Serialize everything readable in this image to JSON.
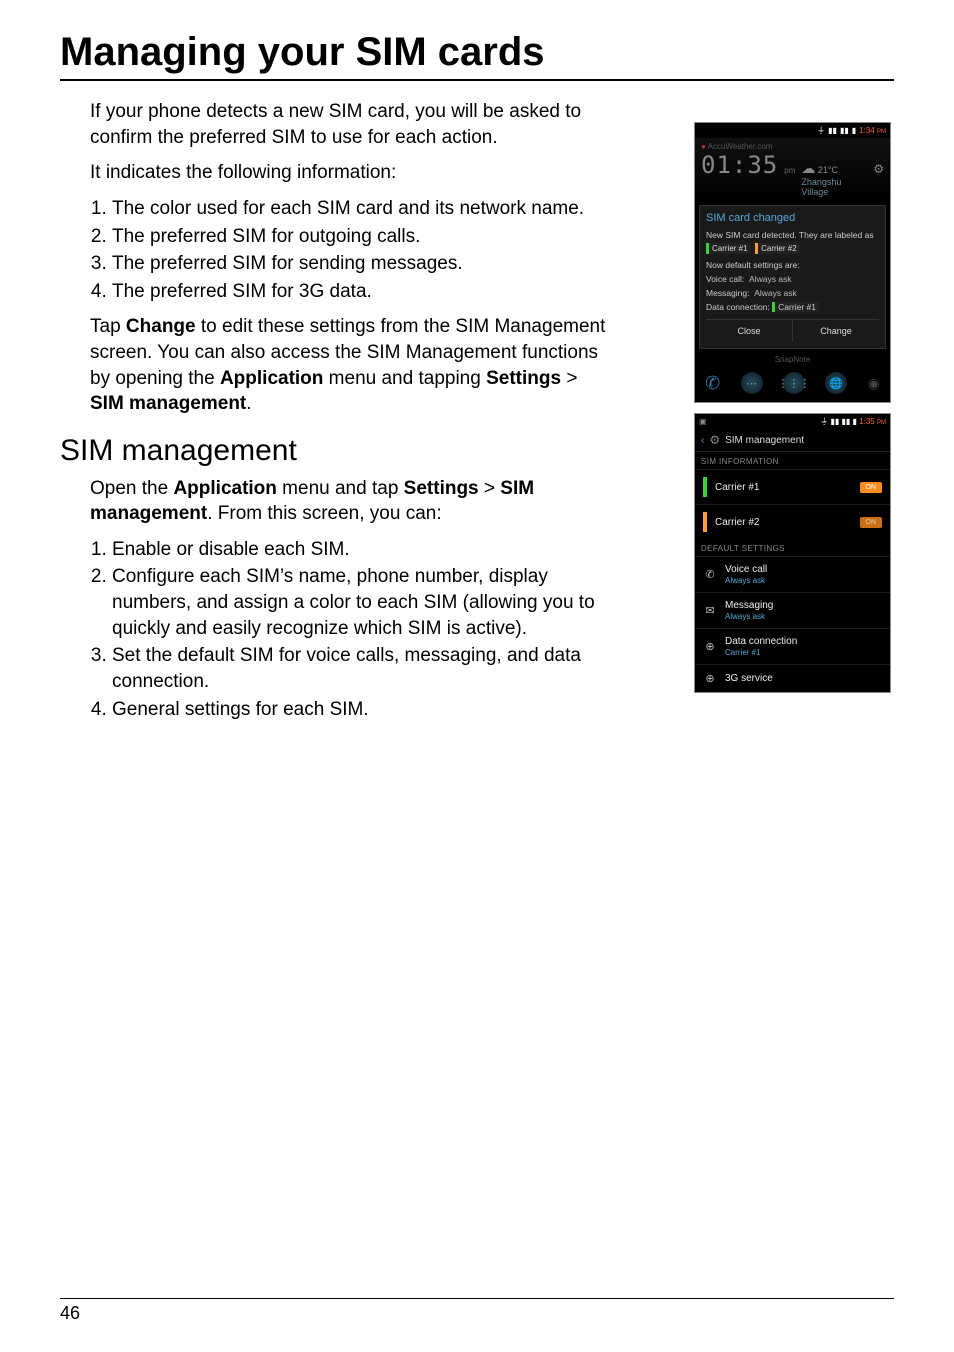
{
  "title": "Managing your SIM cards",
  "p_intro": "If your phone detects a new SIM card, you will be asked to confirm the preferred SIM to use for each action.",
  "p_indicates": "It indicates the following information:",
  "list1": [
    "The color used for each SIM card and its network name.",
    "The preferred SIM for outgoing calls.",
    "The preferred SIM for sending messages.",
    "The preferred SIM for 3G data."
  ],
  "p_change_1": "Tap ",
  "p_change_bold1": "Change",
  "p_change_2": " to edit these settings from the SIM Management screen. You can also access the SIM Management functions by opening the ",
  "p_change_bold2": "Application",
  "p_change_3": " menu and tapping ",
  "p_change_bold3": "Settings",
  "p_change_4": " > ",
  "p_change_bold4": "SIM management",
  "p_change_5": ".",
  "h2": "SIM management",
  "p_sim_1": "Open the ",
  "p_sim_bold1": "Application",
  "p_sim_2": " menu and tap ",
  "p_sim_bold2": "Settings",
  "p_sim_3": " > ",
  "p_sim_bold3": "SIM management",
  "p_sim_4": ". From this screen, you can:",
  "list2": [
    "Enable or disable each SIM.",
    "Configure each SIM’s name, phone number, display numbers, and assign a color to each SIM (allowing you to quickly and easily recognize which SIM is active).",
    "Set the default SIM for voice calls, messaging, and data connection.",
    "General settings for each SIM."
  ],
  "page_num": "46",
  "phone1": {
    "status_time": "1:34",
    "status_pm": "PM",
    "accu": "AccuWeather.com",
    "clock": "01:35",
    "clock_pm": "pm",
    "temp": "21°C",
    "location": "Zhangshu Village",
    "dlg_title": "SIM card changed",
    "dlg_msg": "New SIM card detected. They are labeled as",
    "chip1": "Carrier #1",
    "chip2": "Carrier #2",
    "now_default": "Now default settings are:",
    "voice_lbl": "Voice call:",
    "voice_val": "Always ask",
    "msg_lbl": "Messaging:",
    "msg_val": "Always ask",
    "data_lbl": "Data connection:",
    "data_val": "Carrier #1",
    "btn_close": "Close",
    "btn_change": "Change",
    "snap": "SnapNote"
  },
  "phone2": {
    "status_time": "1:35",
    "status_pm": "PM",
    "header": "SIM management",
    "sect_info": "SIM INFORMATION",
    "carrier1": "Carrier #1",
    "carrier2": "Carrier #2",
    "on": "ON",
    "sect_def": "DEFAULT SETTINGS",
    "voice": "Voice call",
    "voice_sub": "Always ask",
    "msg": "Messaging",
    "msg_sub": "Always ask",
    "data": "Data connection",
    "data_sub": "Carrier #1",
    "g3": "3G service"
  }
}
